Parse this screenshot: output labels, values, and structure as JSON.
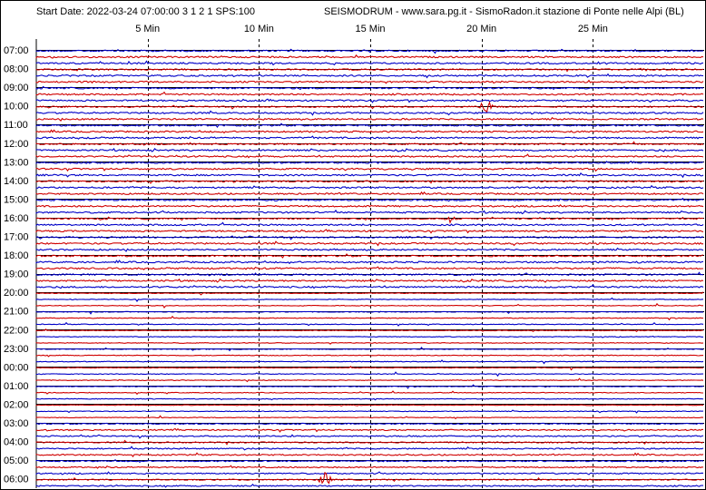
{
  "header": {
    "start_date": "Start Date: 2022-03-24 07:00:00 3 1 2 1 SPS:100",
    "title": "SEISMODRUM - www.sara.pg.it - SismoRadon.it stazione di Ponte nelle Alpi (BL)"
  },
  "chart_data": {
    "type": "line",
    "title": "SEISMODRUM - www.sara.pg.it - SismoRadon.it stazione di Ponte nelle Alpi (BL)",
    "subtitle": "Start Date: 2022-03-24 07:00:00 3 1 2 1 SPS:100",
    "x_ticks": [
      "5 Min",
      "10 Min",
      "15 Min",
      "20 Min",
      "25 Min"
    ],
    "x_tick_minutes": [
      5,
      10,
      15,
      20,
      25
    ],
    "x_range_minutes": [
      0,
      30
    ],
    "grid": true,
    "hours": [
      "07:00",
      "08:00",
      "09:00",
      "10:00",
      "11:00",
      "12:00",
      "13:00",
      "14:00",
      "15:00",
      "16:00",
      "17:00",
      "18:00",
      "19:00",
      "20:00",
      "21:00",
      "22:00",
      "23:00",
      "00:00",
      "01:00",
      "02:00",
      "03:00",
      "04:00",
      "05:00",
      "06:00"
    ],
    "trace_colors": [
      "#0000c8",
      "#d00000"
    ],
    "events": [
      {
        "hour_index": 3,
        "minute": 20.2,
        "amplitude": "large"
      },
      {
        "hour_index": 9,
        "minute": 18.6,
        "amplitude": "medium"
      },
      {
        "hour_index": 23,
        "minute": 13.0,
        "amplitude": "large"
      }
    ]
  },
  "colors": {
    "blue_trace": "#0000c8",
    "red_trace": "#d00000",
    "grid": "#000000"
  }
}
